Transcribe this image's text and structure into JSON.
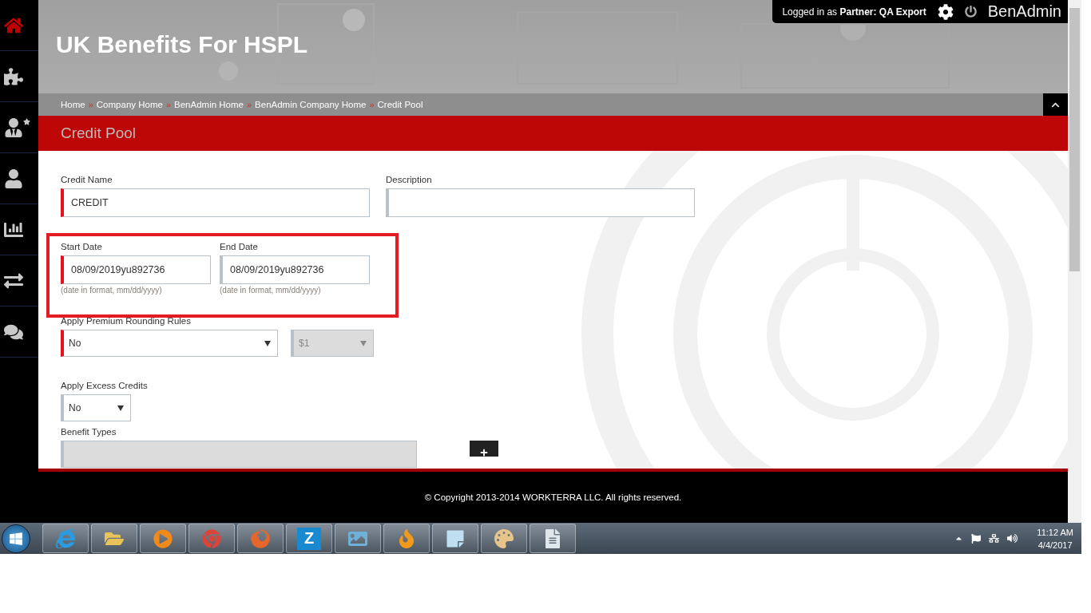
{
  "sidebar": {
    "items": [
      {
        "kind": "home",
        "selected": true
      },
      {
        "kind": "puzzle",
        "selected": false
      },
      {
        "kind": "user-star",
        "selected": false
      },
      {
        "kind": "user",
        "selected": false
      },
      {
        "kind": "chart",
        "selected": false
      },
      {
        "kind": "transfer",
        "selected": false
      },
      {
        "kind": "chat",
        "selected": false
      }
    ]
  },
  "user_bar": {
    "prefix": "Logged in as",
    "role": "Partner:",
    "name": "QA Export",
    "app": "BenAdmin"
  },
  "header": {
    "title": "UK Benefits For HSPL"
  },
  "breadcrumb": {
    "separator": "»",
    "items": [
      "Home",
      "Company Home",
      "BenAdmin Home",
      "BenAdmin Company Home",
      "Credit Pool"
    ]
  },
  "page_title": "Credit Pool",
  "form": {
    "credit_name": {
      "label": "Credit Name",
      "value": "CREDIT",
      "required": true
    },
    "description": {
      "label": "Description",
      "required": false
    },
    "start_date": {
      "label": "Start Date",
      "value": "08/09/2019yu892736",
      "hint": "(date in format, mm/dd/yyyy)",
      "required": true
    },
    "end_date": {
      "label": "End Date",
      "value": "08/09/2019yu892736",
      "hint": "(date in format, mm/dd/yyyy)",
      "required": false
    },
    "rounding": {
      "label": "Apply Premium Rounding Rules",
      "value": "No",
      "required": true,
      "amount": {
        "value": "$1",
        "disabled": true
      }
    },
    "excess": {
      "label": "Apply Excess Credits",
      "value": "No",
      "required": false
    },
    "benefit_types": {
      "label": "Benefit Types",
      "disabled": true
    }
  },
  "footer": {
    "text": "© Copyright 2013-2014 WORKTERRA LLC. All rights reserved."
  },
  "taskbar": {
    "apps": [
      {
        "kind": "browser-e"
      },
      {
        "kind": "folder"
      },
      {
        "kind": "media"
      },
      {
        "kind": "chrome"
      },
      {
        "kind": "fox"
      },
      {
        "kind": "letter",
        "label": "Z"
      },
      {
        "kind": "image"
      },
      {
        "kind": "flame"
      },
      {
        "kind": "notepad"
      },
      {
        "kind": "paint"
      },
      {
        "kind": "document"
      }
    ],
    "time": "11:12 AM",
    "date": "4/4/2017"
  }
}
